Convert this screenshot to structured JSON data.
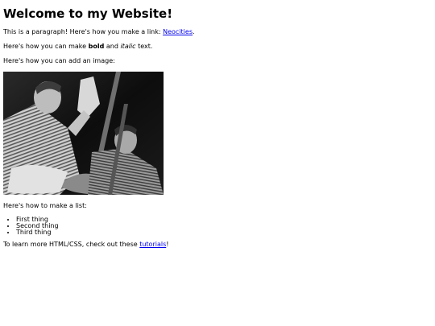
{
  "page": {
    "heading": "Welcome to my Website!",
    "para1_text": "This is a paragraph! Here's how you make a link: ",
    "para1_link": "Neocities",
    "para1_end": ".",
    "para2_before": "Here's how you can make ",
    "para2_bold": "bold",
    "para2_mid": " and ",
    "para2_italic": "italic",
    "para2_end": " text.",
    "para3": "Here's how you can add an image:",
    "list_intro": "Here's how to make a list:",
    "list_items": [
      "First thing",
      "Second thing",
      "Third thing"
    ],
    "footer_text": "To learn more HTML/CSS, check out these ",
    "footer_link": "tutorials",
    "footer_end": "!"
  },
  "colors": {
    "link": "#0000ee",
    "text": "#000000",
    "background": "#ffffff"
  }
}
